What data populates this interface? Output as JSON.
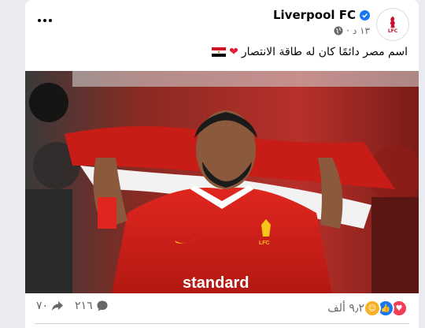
{
  "post": {
    "page_name": "Liverpool FC",
    "logo_text": "LFC",
    "timestamp": "١٣ د",
    "caption": "اسم مصر دائمًا كان له طاقة الانتصار",
    "verified": true
  },
  "photo": {
    "shirt_sponsor": "standard",
    "crest_text": "LFC"
  },
  "stats": {
    "reaction_count": "٩٫٢ ألف",
    "reactions": [
      "love-icon",
      "like-icon",
      "care-icon"
    ],
    "comments_count": "٢١٦",
    "shares_count": "٧٠"
  },
  "colors": {
    "brand_red": "#c8102e",
    "verified_blue": "#1877f2",
    "love_red": "#f33e58"
  }
}
